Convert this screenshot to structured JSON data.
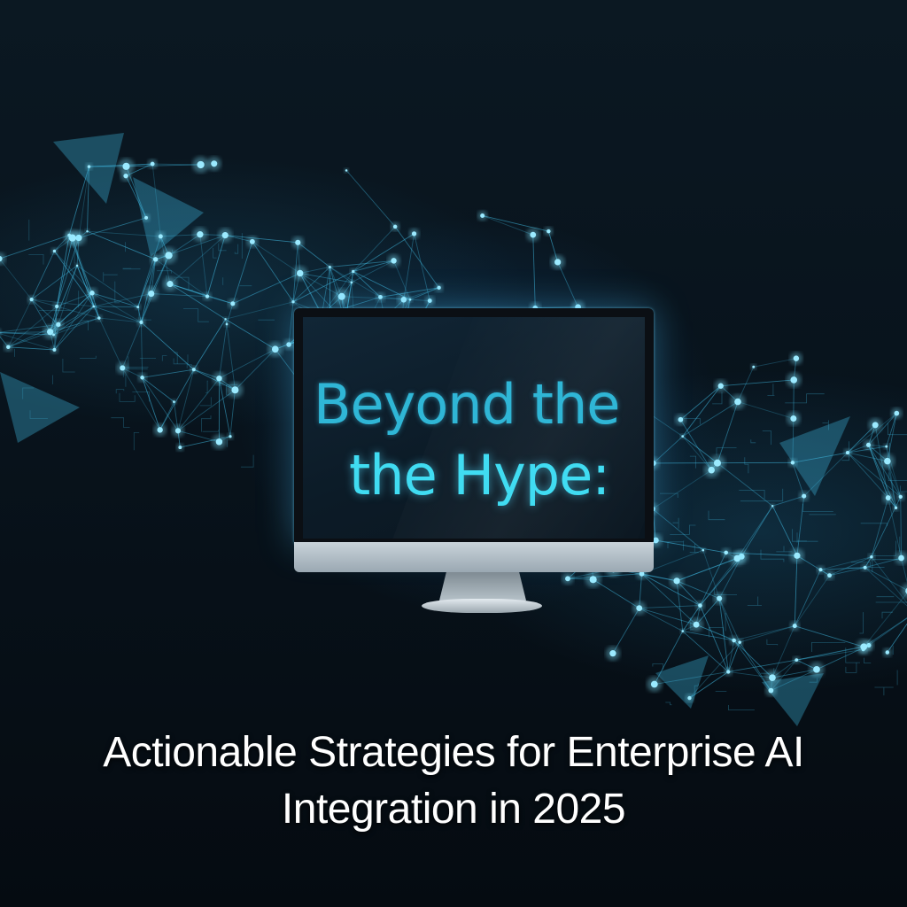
{
  "monitor": {
    "screen_line_1": "Beyond  the",
    "screen_line_2": "the Hype:"
  },
  "caption": {
    "line_1": "Actionable Strategies for Enterprise AI",
    "line_2": "Integration in 2025"
  },
  "colors": {
    "background": "#071018",
    "accent_glow": "#40dcf2",
    "network_line": "#3fb8e0",
    "caption_text": "#ffffff"
  }
}
